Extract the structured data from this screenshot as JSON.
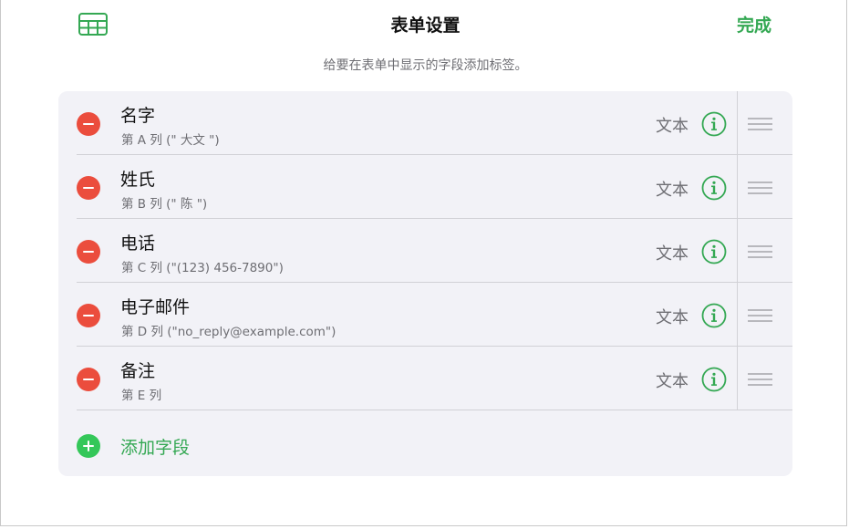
{
  "header": {
    "grid_icon": "table-grid-icon",
    "title": "表单设置",
    "done_label": "完成",
    "subtitle": "给要在表单中显示的字段添加标签。"
  },
  "fields": [
    {
      "name": "名字",
      "column": "第 A 列 (\" 大文 \")",
      "type": "文本"
    },
    {
      "name": "姓氏",
      "column": "第 B 列 (\" 陈 \")",
      "type": "文本"
    },
    {
      "name": "电话",
      "column": "第 C 列 (\"(123) 456-7890\")",
      "type": "文本"
    },
    {
      "name": "电子邮件",
      "column": "第 D 列 (\"no_reply@example.com\")",
      "type": "文本"
    },
    {
      "name": "备注",
      "column": "第 E 列",
      "type": "文本"
    }
  ],
  "add_field": {
    "label": "添加字段",
    "icon": "plus-circle-icon"
  },
  "icons": {
    "remove": "minus-circle-icon",
    "info": "info-icon",
    "reorder": "drag-handle-icon"
  },
  "colors": {
    "accent_green": "#34a853",
    "remove_red": "#eb4d3d",
    "add_green": "#34c759",
    "card_bg": "#f2f2f7",
    "secondary_text": "#6e6e73"
  }
}
